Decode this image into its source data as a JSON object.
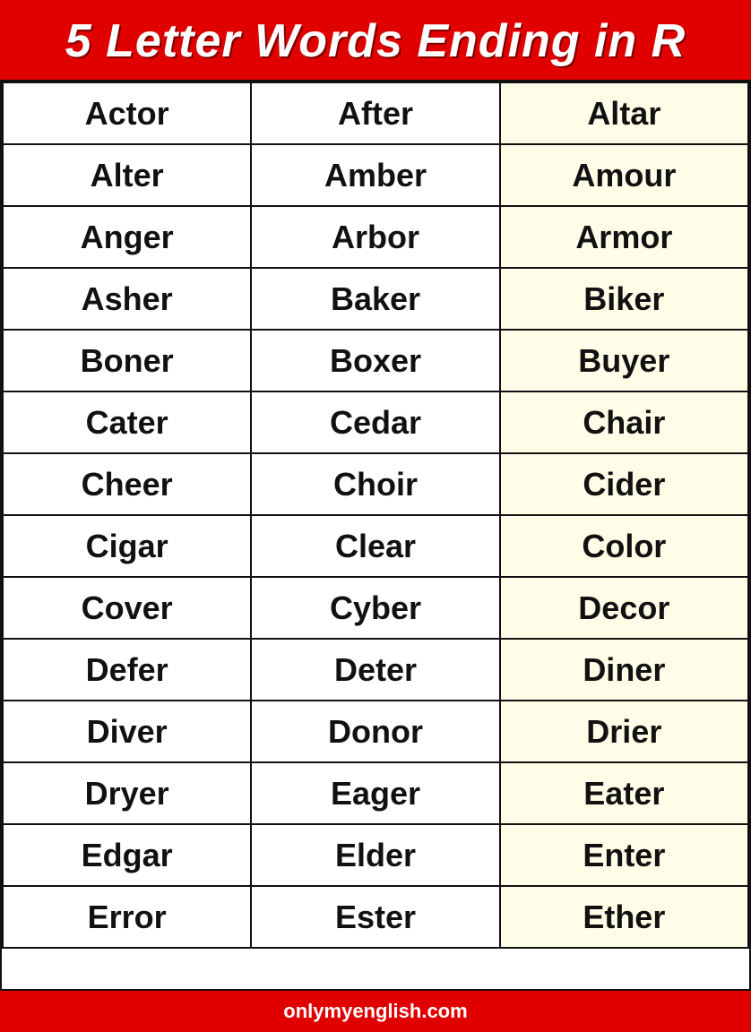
{
  "header": {
    "title": "5 Letter Words Ending in R"
  },
  "footer": {
    "website": "onlymyenglish.com"
  },
  "rows": [
    [
      "Actor",
      "After",
      "Altar"
    ],
    [
      "Alter",
      "Amber",
      "Amour"
    ],
    [
      "Anger",
      "Arbor",
      "Armor"
    ],
    [
      "Asher",
      "Baker",
      "Biker"
    ],
    [
      "Boner",
      "Boxer",
      "Buyer"
    ],
    [
      "Cater",
      "Cedar",
      "Chair"
    ],
    [
      "Cheer",
      "Choir",
      "Cider"
    ],
    [
      "Cigar",
      "Clear",
      "Color"
    ],
    [
      "Cover",
      "Cyber",
      "Decor"
    ],
    [
      "Defer",
      "Deter",
      "Diner"
    ],
    [
      "Diver",
      "Donor",
      "Drier"
    ],
    [
      "Dryer",
      "Eager",
      "Eater"
    ],
    [
      "Edgar",
      "Elder",
      "Enter"
    ],
    [
      "Error",
      "Ester",
      "Ether"
    ]
  ]
}
